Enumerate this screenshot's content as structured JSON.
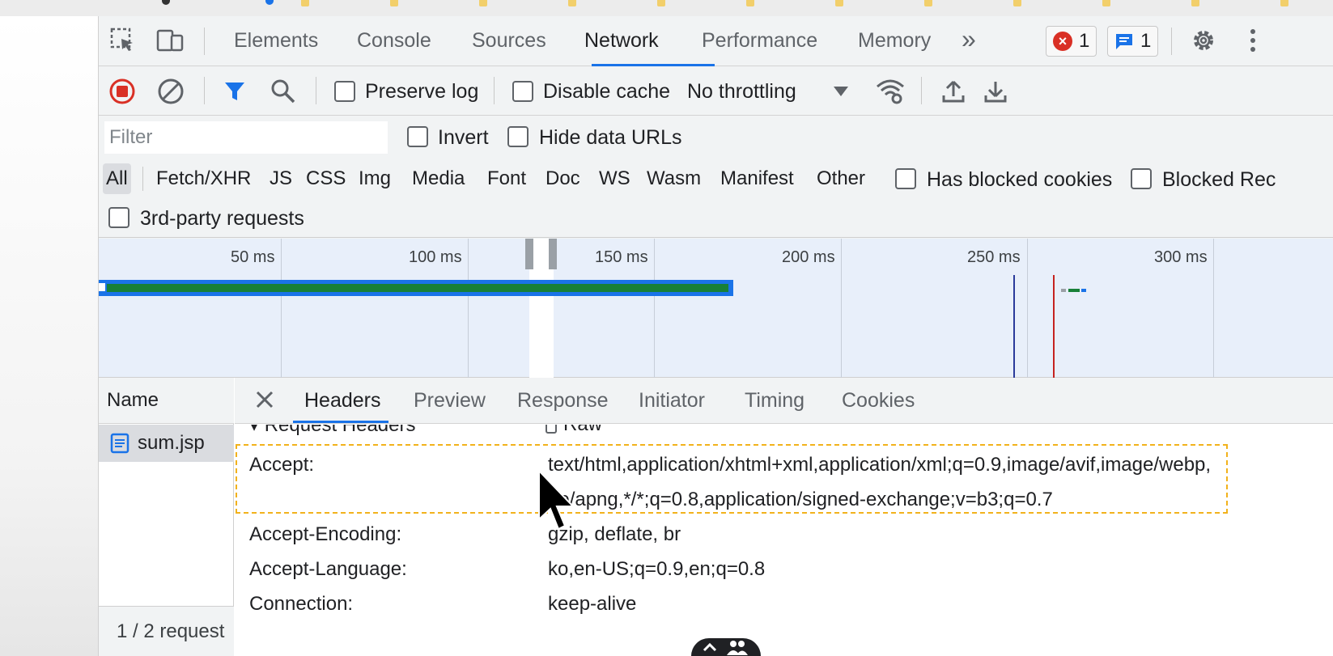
{
  "tabbar": {
    "inspect_icon": "inspect-element-icon",
    "device_icon": "device-toolbar-icon",
    "tabs": [
      {
        "label": "Elements"
      },
      {
        "label": "Console"
      },
      {
        "label": "Sources"
      },
      {
        "label": "Network"
      },
      {
        "label": "Performance"
      },
      {
        "label": "Memory"
      }
    ],
    "active_tab": "Network",
    "more_tabs_label": "»",
    "errors_count": "1",
    "messages_count": "1",
    "settings_icon": "gear-icon",
    "menu_icon": "kebab-icon"
  },
  "toolbar": {
    "preserve_log_label": "Preserve log",
    "disable_cache_label": "Disable cache",
    "throttling_value": "No throttling"
  },
  "filter": {
    "placeholder": "Filter",
    "invert_label": "Invert",
    "hide_data_urls_label": "Hide data URLs"
  },
  "type_filters": [
    {
      "label": "All",
      "active": true
    },
    {
      "label": "Fetch/XHR"
    },
    {
      "label": "JS"
    },
    {
      "label": "CSS"
    },
    {
      "label": "Img"
    },
    {
      "label": "Media"
    },
    {
      "label": "Font"
    },
    {
      "label": "Doc"
    },
    {
      "label": "WS"
    },
    {
      "label": "Wasm"
    },
    {
      "label": "Manifest"
    },
    {
      "label": "Other"
    }
  ],
  "extra_filters": {
    "has_blocked_cookies_label": "Has blocked cookies",
    "blocked_requests_label": "Blocked Rec",
    "third_party_label": "3rd-party requests"
  },
  "overview": {
    "ticks": [
      "50 ms",
      "100 ms",
      "150 ms",
      "200 ms",
      "250 ms",
      "300 ms"
    ]
  },
  "requests": {
    "name_header": "Name",
    "items": [
      {
        "name": "sum.jsp"
      }
    ],
    "footer": "1 / 2 request"
  },
  "details": {
    "tabs": [
      "Headers",
      "Preview",
      "Response",
      "Initiator",
      "Timing",
      "Cookies"
    ],
    "active_tab": "Headers",
    "section_title": "▾ Request Headers",
    "raw_label": "Raw",
    "headers": [
      {
        "key": "Accept:",
        "value_line1": "text/html,application/xhtml+xml,application/xml;q=0.9,image/avif,image/webp,",
        "value_line2": "ge/apng,*/*;q=0.8,application/signed-exchange;v=b3;q=0.7"
      },
      {
        "key": "Accept-Encoding:",
        "value": "gzip, deflate, br"
      },
      {
        "key": "Accept-Language:",
        "value": "ko,en-US;q=0.9,en;q=0.8"
      },
      {
        "key": "Connection:",
        "value": "keep-alive"
      }
    ]
  },
  "colors": {
    "accent": "#1a73e8",
    "record_red": "#d93025",
    "waterfall_green": "#188038",
    "highlight_border": "#f2b21c"
  }
}
